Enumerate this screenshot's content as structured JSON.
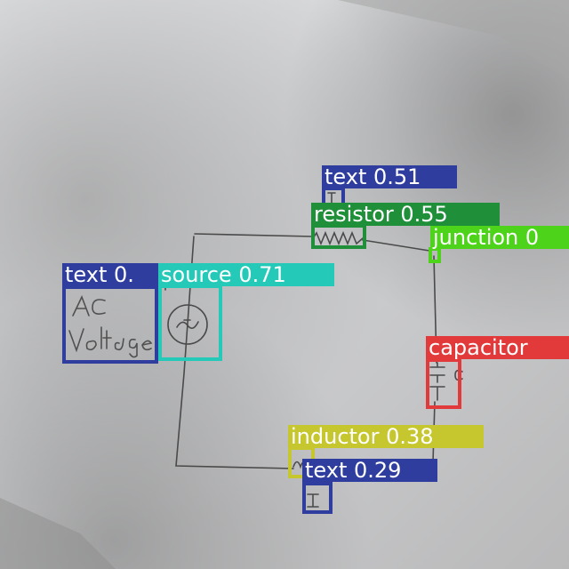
{
  "detections": [
    {
      "label": "text",
      "score": "0.51",
      "color": "#2f3e9e"
    },
    {
      "label": "resistor",
      "score": "0.55",
      "color": "#1f8f3a"
    },
    {
      "label": "junction",
      "score": "0",
      "color": "#4ed31b"
    },
    {
      "label": "text",
      "score": "0.",
      "color": "#2f3e9e"
    },
    {
      "label": "source",
      "score": "0.71",
      "color": "#25c9b8"
    },
    {
      "label": "capacitor",
      "score": "",
      "color": "#e23a3a"
    },
    {
      "label": "inductor",
      "score": "0.38",
      "color": "#c6c62e"
    },
    {
      "label": "text",
      "score": "0.29",
      "color": "#2f3e9e"
    }
  ]
}
